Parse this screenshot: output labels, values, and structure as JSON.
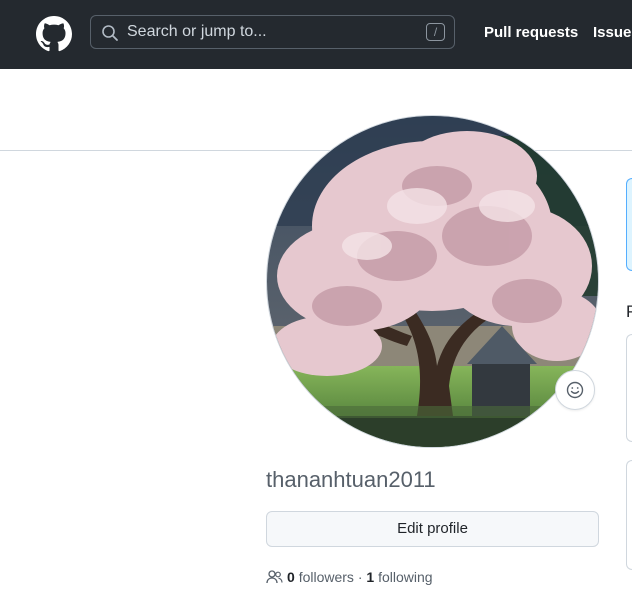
{
  "header": {
    "search": {
      "placeholder": "Search or jump to...",
      "shortcut": "/"
    },
    "nav": {
      "pull_requests": "Pull requests",
      "issues": "Issues"
    }
  },
  "profile": {
    "username": "thananhtuan2011",
    "edit_label": "Edit profile",
    "followers_count": "0",
    "followers_label": "followers",
    "separator": "·",
    "following_count": "1",
    "following_label": "following"
  },
  "sidebar_partial": {
    "letter": "P"
  },
  "icons": {
    "logo": "github-logo-icon",
    "search": "search-icon",
    "status": "smiley-icon",
    "people": "people-icon"
  },
  "colors": {
    "header_bg": "#24292f",
    "muted_text": "#57606a",
    "border": "#d0d7de",
    "info_bg": "#ddf4ff",
    "info_border": "#54aeff"
  }
}
